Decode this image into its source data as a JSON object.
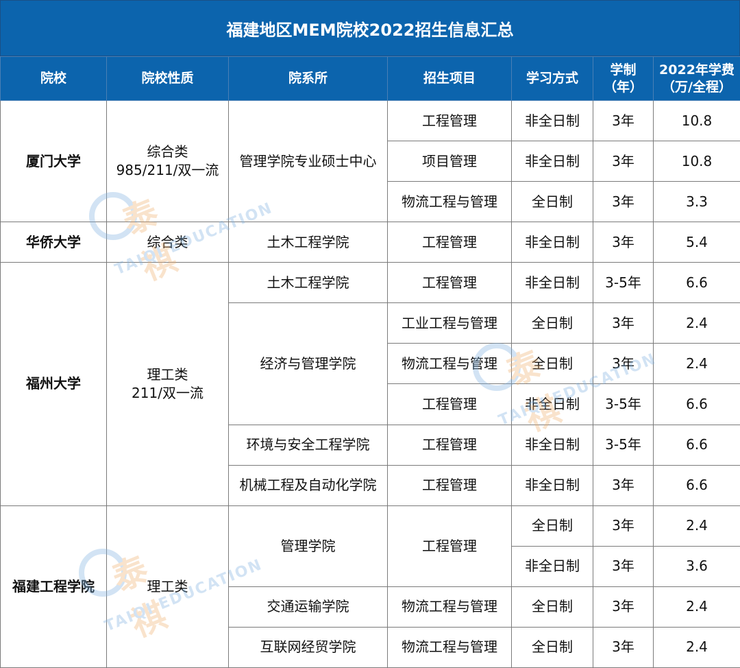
{
  "title": "福建地区MEM院校2022招生信息汇总",
  "headers": [
    "院校",
    "院校性质",
    "院系所",
    "招生项目",
    "学习方式",
    "学制\n（年）",
    "2022年学费\n（万/全程）"
  ],
  "schools": {
    "xmu": {
      "name": "厦门大学",
      "type": "综合类\n985/211/双一流",
      "dept": "管理学院专业硕士中心",
      "rows": [
        {
          "program": "工程管理",
          "mode": "非全日制",
          "years": "3年",
          "fee": "10.8"
        },
        {
          "program": "项目管理",
          "mode": "非全日制",
          "years": "3年",
          "fee": "10.8"
        },
        {
          "program": "物流工程与管理",
          "mode": "全日制",
          "years": "3年",
          "fee": "3.3"
        }
      ]
    },
    "hqu": {
      "name": "华侨大学",
      "type": "综合类",
      "dept": "土木工程学院",
      "rows": [
        {
          "program": "工程管理",
          "mode": "非全日制",
          "years": "3年",
          "fee": "5.4"
        }
      ]
    },
    "fzu": {
      "name": "福州大学",
      "type": "理工类\n211/双一流",
      "depts": [
        "土木工程学院",
        "经济与管理学院",
        "环境与安全工程学院",
        "机械工程及自动化学院"
      ],
      "rows": [
        {
          "program": "工程管理",
          "mode": "非全日制",
          "years": "3-5年",
          "fee": "6.6"
        },
        {
          "program": "工业工程与管理",
          "mode": "全日制",
          "years": "3年",
          "fee": "2.4"
        },
        {
          "program": "物流工程与管理",
          "mode": "全日制",
          "years": "3年",
          "fee": "2.4"
        },
        {
          "program": "工程管理",
          "mode": "非全日制",
          "years": "3-5年",
          "fee": "6.6"
        },
        {
          "program": "工程管理",
          "mode": "非全日制",
          "years": "3-5年",
          "fee": "6.6"
        },
        {
          "program": "工程管理",
          "mode": "非全日制",
          "years": "3年",
          "fee": "6.6"
        }
      ]
    },
    "fjut": {
      "name": "福建工程学院",
      "type": "理工类",
      "depts": [
        "管理学院",
        "交通运输学院",
        "互联网经贸学院"
      ],
      "rows": [
        {
          "program": "工程管理",
          "mode": "全日制",
          "years": "3年",
          "fee": "2.4"
        },
        {
          "program": "",
          "mode": "非全日制",
          "years": "3年",
          "fee": "3.6"
        },
        {
          "program": "物流工程与管理",
          "mode": "全日制",
          "years": "3年",
          "fee": "2.4"
        },
        {
          "program": "物流工程与管理",
          "mode": "全日制",
          "years": "3年",
          "fee": "2.4"
        }
      ]
    }
  },
  "watermark": {
    "cn": "泰祺",
    "en": "TAIQI EDUCATION",
    "mark": "®",
    "brand_color": "#7fb2e0",
    "accent_color": "#f0b070"
  },
  "colors": {
    "header_bg": "#0c64ad",
    "header_text": "#ffffff",
    "border": "#7a7a7a"
  }
}
